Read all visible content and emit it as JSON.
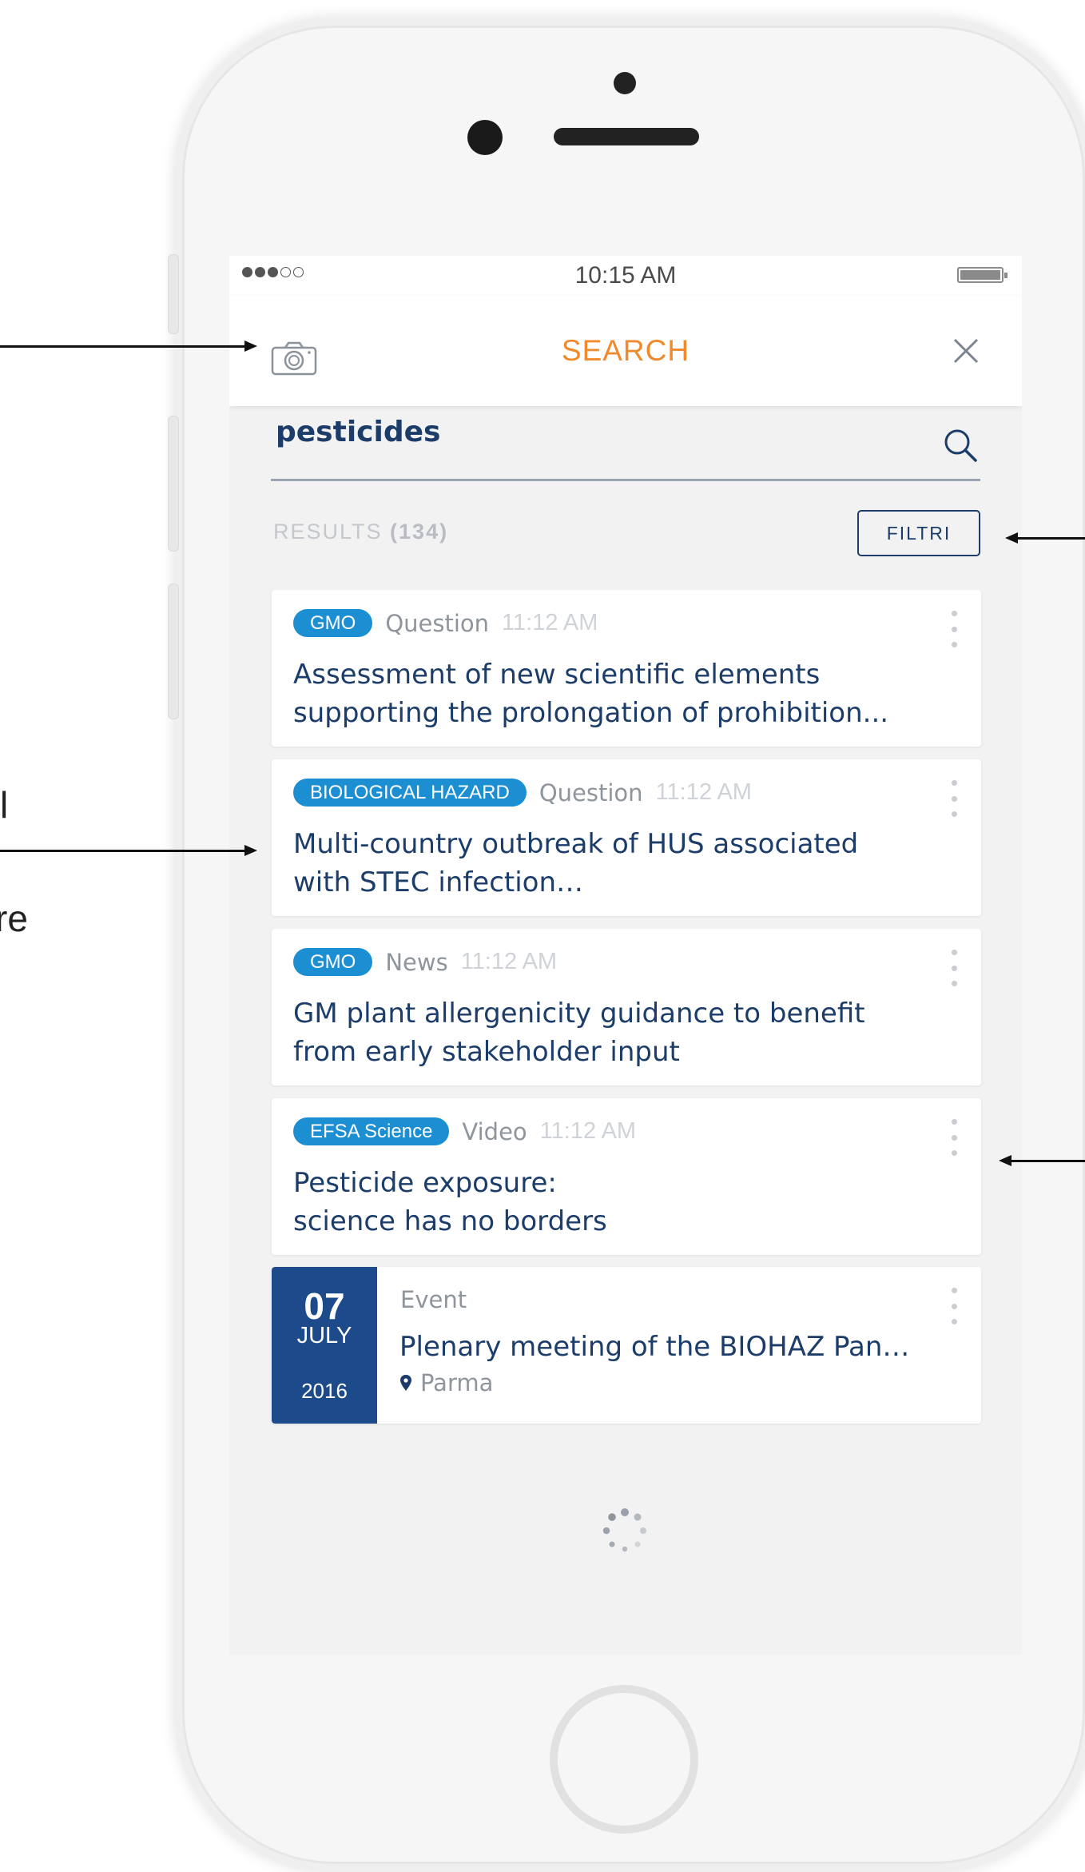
{
  "status_bar": {
    "time": "10:15 AM"
  },
  "header": {
    "title": "SEARCH",
    "camera_icon": "camera-icon",
    "close_icon": "close-icon"
  },
  "search": {
    "query": "pesticides",
    "search_icon": "search-icon"
  },
  "results": {
    "label": "RESULTS",
    "count": "(134)",
    "filter_label": "FILTRI"
  },
  "cards": [
    {
      "tag": "GMO",
      "type": "Question",
      "time": "11:12 AM",
      "title": "Assessment of new scientific elements supporting the prolongation of prohibition..."
    },
    {
      "tag": "BIOLOGICAL HAZARD",
      "type": "Question",
      "time": "11:12 AM",
      "title": "Multi-country outbreak of HUS associated with STEC infection…"
    },
    {
      "tag": "GMO",
      "type": "News",
      "time": "11:12 AM",
      "title": "GM plant allergenicity guidance to benefit from early stakeholder input"
    },
    {
      "tag": "EFSA Science",
      "type": "Video",
      "time": "11:12 AM",
      "title": "Pesticide exposure: science has no borders"
    }
  ],
  "event_card": {
    "day": "07",
    "month": "JULY",
    "year": "2016",
    "type": "Event",
    "title": "Plenary meeting of the BIOHAZ Pan…",
    "location": "Parma",
    "location_icon": "map-pin-icon"
  },
  "annotations": {
    "left_fragment_1": "l",
    "left_fragment_2": "re"
  },
  "colors": {
    "accent_orange": "#f08a2c",
    "navy": "#1c3d6a",
    "tag_blue": "#1c8fd3",
    "event_blue": "#1c4a8a"
  }
}
